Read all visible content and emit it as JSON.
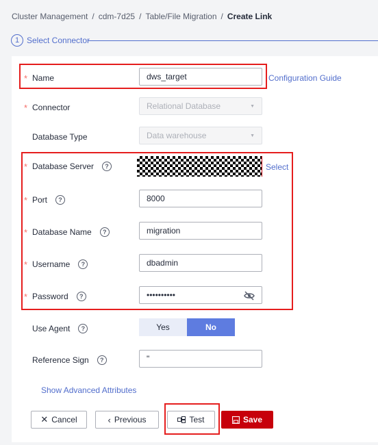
{
  "breadcrumb": {
    "items": [
      "Cluster Management",
      "cdm-7d25",
      "Table/File Migration"
    ],
    "current": "Create Link",
    "separator": "/"
  },
  "step": {
    "number": "1",
    "label": "Select Connector"
  },
  "form": {
    "name": {
      "label": "Name",
      "value": "dws_target",
      "link": "Configuration Guide"
    },
    "connector": {
      "label": "Connector",
      "value": "Relational Database"
    },
    "database_type": {
      "label": "Database Type",
      "value": "Data warehouse"
    },
    "database_server": {
      "label": "Database Server",
      "link": "Select"
    },
    "port": {
      "label": "Port",
      "value": "8000"
    },
    "database_name": {
      "label": "Database Name",
      "value": "migration"
    },
    "username": {
      "label": "Username",
      "value": "dbadmin"
    },
    "password": {
      "label": "Password",
      "value": "••••••••••"
    },
    "use_agent": {
      "label": "Use Agent",
      "options": [
        "Yes",
        "No"
      ],
      "selected": "No"
    },
    "reference_sign": {
      "label": "Reference Sign",
      "value": "\""
    },
    "advanced_link": "Show Advanced Attributes",
    "required_mark": "*",
    "help_mark": "?"
  },
  "buttons": {
    "cancel": "Cancel",
    "previous": "Previous",
    "test": "Test",
    "save": "Save"
  },
  "colors": {
    "accent": "#526ecc",
    "primary": "#c7000b",
    "highlight": "#e51d1d"
  }
}
